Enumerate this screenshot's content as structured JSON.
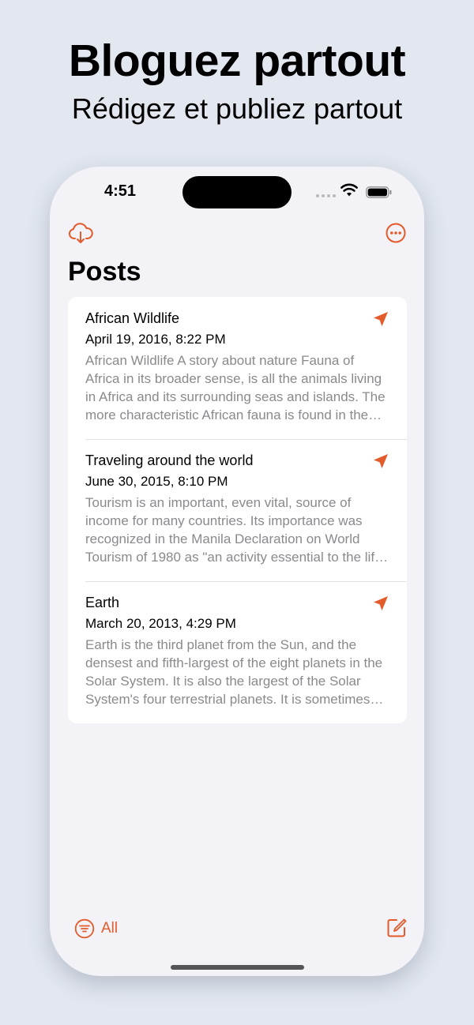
{
  "promo": {
    "headline": "Bloguez partout",
    "subheadline": "Rédigez et publiez partout"
  },
  "status_bar": {
    "time": "4:51"
  },
  "nav": {
    "left_icon": "cloud-download-icon",
    "right_icon": "more-ellipsis-icon",
    "title": "Posts"
  },
  "posts": [
    {
      "title": "African Wildlife",
      "date": "April 19, 2016, 8:22 PM",
      "excerpt": "African Wildlife A story about nature    Fauna of Africa in its broader sense, is all the animals living in Africa and its surrounding seas and islands. The more characteristic African fauna is found in the Ethiopian realm.",
      "status_icon": "published-send-icon"
    },
    {
      "title": "Traveling around the world",
      "date": "June 30, 2015, 8:10 PM",
      "excerpt": "Tourism is an important, even vital, source of income for many countries. Its importance was recognized in the Manila Declaration on World Tourism of 1980 as \"an activity essential to the life of nations\".",
      "status_icon": "published-send-icon"
    },
    {
      "title": "Earth",
      "date": "March 20, 2013, 4:29 PM",
      "excerpt": "Earth is the third planet from the Sun, and the densest and fifth-largest of the eight planets in the Solar System. It is also the largest of the Solar System's four terrestrial planets. It is sometimes referred to as the world.",
      "status_icon": "published-send-icon"
    }
  ],
  "toolbar": {
    "filter_label": "All",
    "filter_icon": "filter-icon",
    "compose_icon": "compose-icon"
  },
  "colors": {
    "accent": "#e35b2a",
    "background": "#e2e7f0",
    "screen": "#f2f2f7",
    "card": "#ffffff",
    "excerpt_text": "#8a8a8e"
  }
}
